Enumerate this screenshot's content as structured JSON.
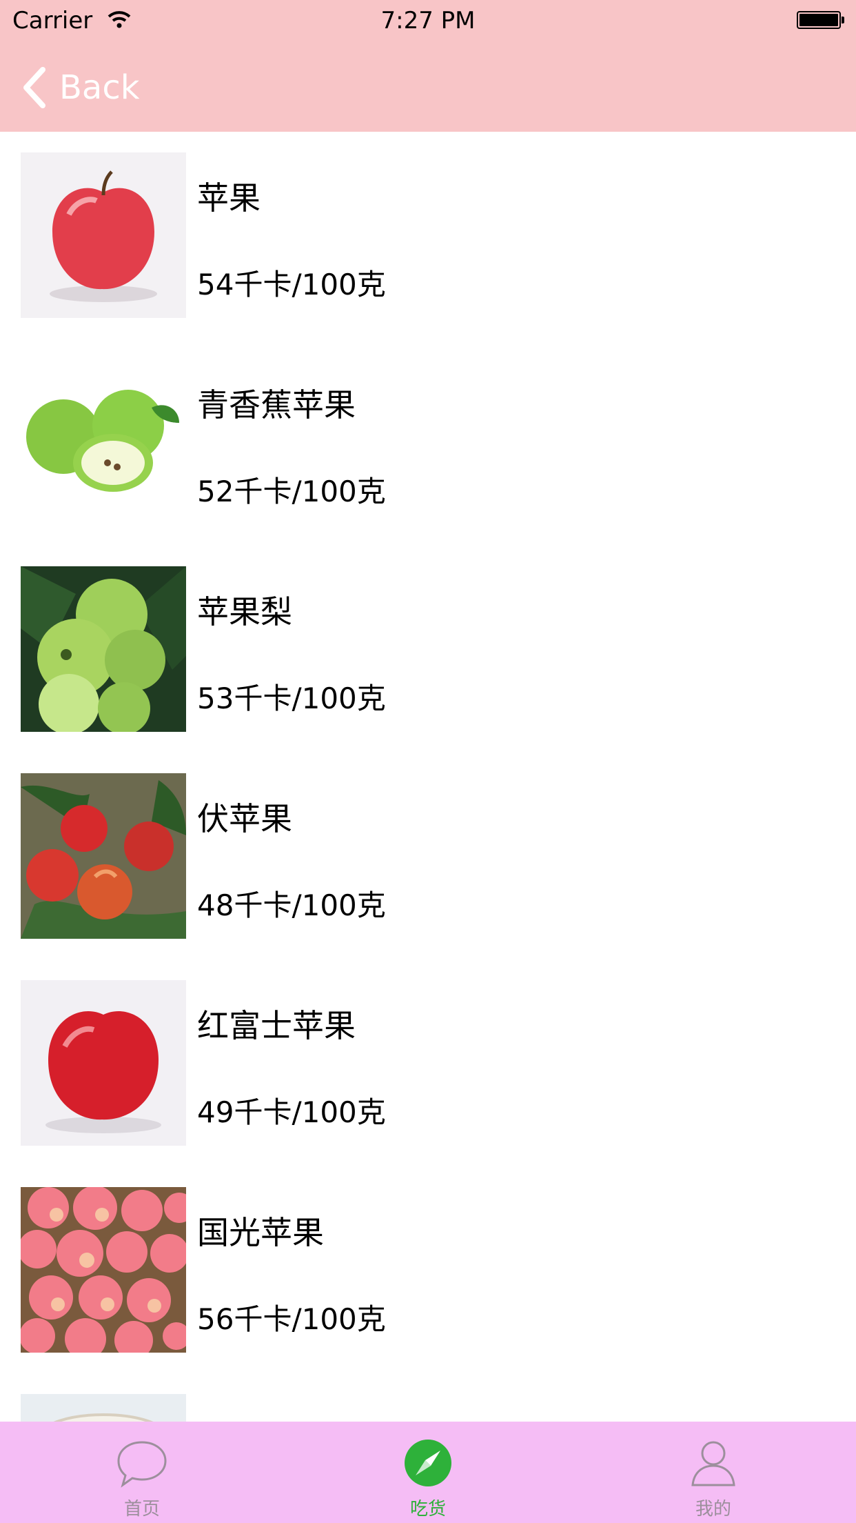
{
  "status_bar": {
    "carrier": "Carrier",
    "time": "7:27 PM"
  },
  "nav": {
    "back_label": "Back"
  },
  "list": {
    "items": [
      {
        "name": "苹果",
        "calories": "54千卡/100克"
      },
      {
        "name": "青香蕉苹果",
        "calories": "52千卡/100克"
      },
      {
        "name": "苹果梨",
        "calories": "53千卡/100克"
      },
      {
        "name": "伏苹果",
        "calories": "48千卡/100克"
      },
      {
        "name": "红富士苹果",
        "calories": "49千卡/100克"
      },
      {
        "name": "国光苹果",
        "calories": "56千卡/100克"
      }
    ]
  },
  "tab_bar": {
    "tabs": [
      {
        "label": "首页",
        "icon": "chat-bubble-icon"
      },
      {
        "label": "吃货",
        "icon": "compass-icon",
        "active": true
      },
      {
        "label": "我的",
        "icon": "person-icon"
      }
    ],
    "active_color": "#2eb13a"
  }
}
